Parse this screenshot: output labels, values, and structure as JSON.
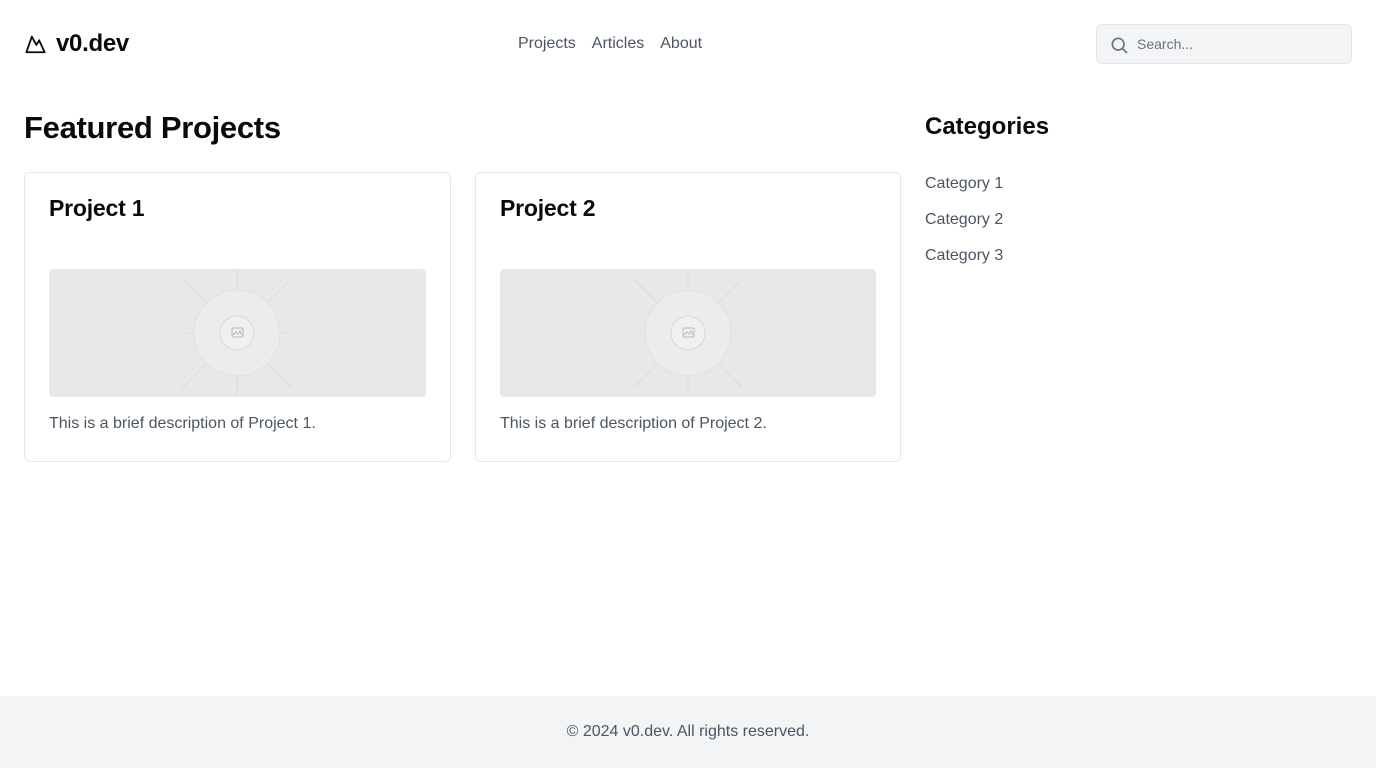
{
  "header": {
    "brand": {
      "name": "v0.dev",
      "icon": "mountain-icon"
    },
    "nav": [
      {
        "label": "Projects"
      },
      {
        "label": "Articles"
      },
      {
        "label": "About"
      }
    ],
    "search": {
      "placeholder": "Search...",
      "value": "",
      "icon": "search-icon"
    }
  },
  "main": {
    "title": "Featured Projects",
    "projects": [
      {
        "title": "Project 1",
        "description": "This is a brief description of Project 1.",
        "image": "image-placeholder-icon"
      },
      {
        "title": "Project 2",
        "description": "This is a brief description of Project 2.",
        "image": "image-placeholder-icon"
      }
    ]
  },
  "sidebar": {
    "title": "Categories",
    "categories": [
      {
        "label": "Category 1"
      },
      {
        "label": "Category 2"
      },
      {
        "label": "Category 3"
      }
    ]
  },
  "footer": {
    "text": "© 2024 v0.dev. All rights reserved."
  },
  "colors": {
    "text_primary": "#0a0a0a",
    "text_muted": "#4b5563",
    "footer_bg": "#f3f4f6",
    "placeholder_bg": "#e8e8e8",
    "border": "#e5e7eb"
  }
}
